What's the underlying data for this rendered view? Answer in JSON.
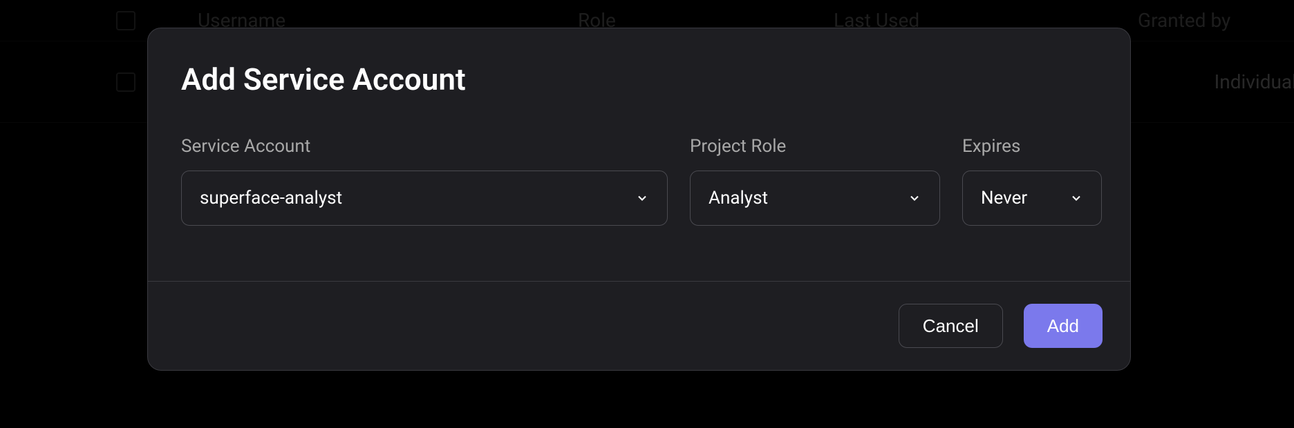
{
  "table": {
    "headers": {
      "username": "Username",
      "role": "Role",
      "last_used": "Last Used",
      "granted_by": "Granted by"
    },
    "row": {
      "granted_by": "Individual G"
    }
  },
  "modal": {
    "title": "Add Service Account",
    "fields": {
      "service_account": {
        "label": "Service Account",
        "value": "superface-analyst"
      },
      "project_role": {
        "label": "Project Role",
        "value": "Analyst"
      },
      "expires": {
        "label": "Expires",
        "value": "Never"
      }
    },
    "buttons": {
      "cancel": "Cancel",
      "add": "Add"
    }
  }
}
